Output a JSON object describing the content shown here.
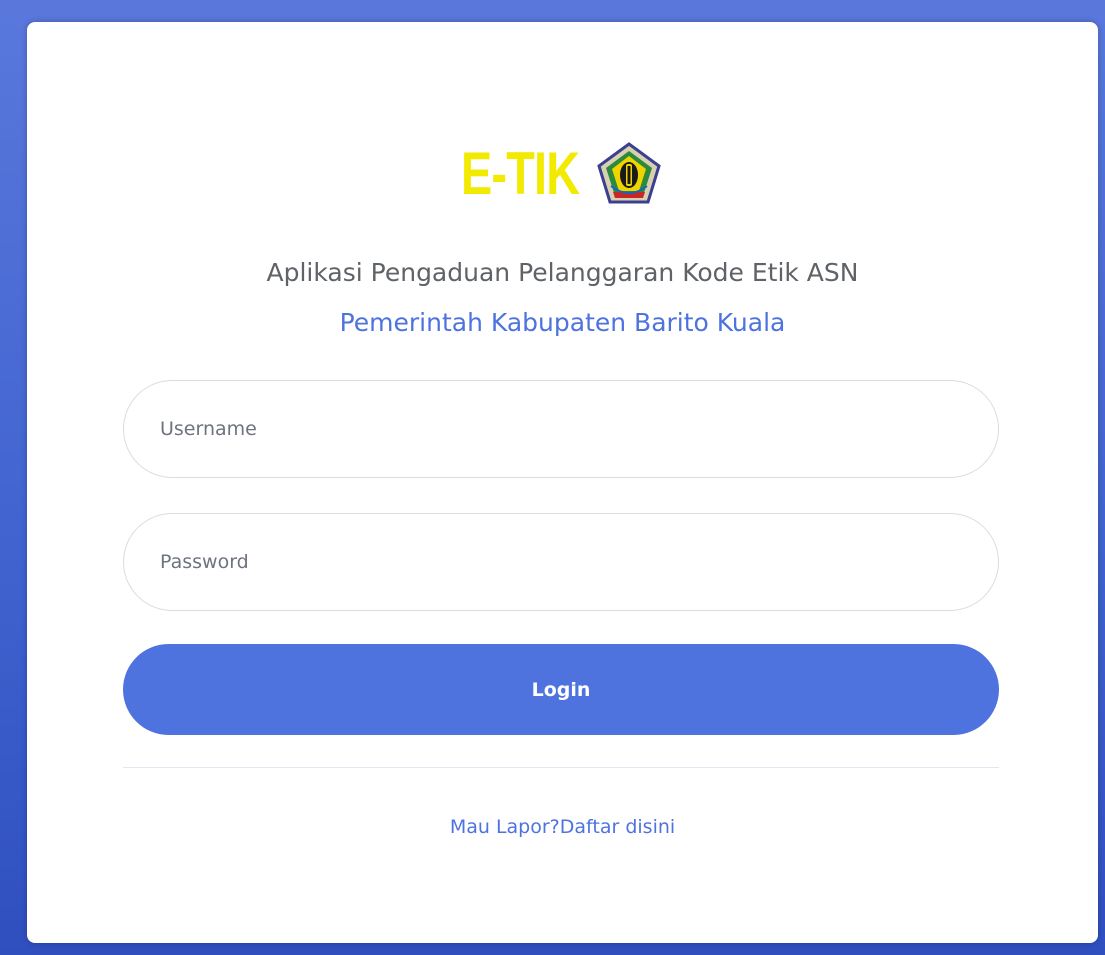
{
  "logo": {
    "text": "E-TIK",
    "text_color": "#f2ea00",
    "emblem_icon": "regency-emblem-icon"
  },
  "header": {
    "app_title": "Aplikasi Pengaduan Pelanggaran Kode Etik ASN",
    "org_name": "Pemerintah Kabupaten Barito Kuala"
  },
  "form": {
    "username_placeholder": "Username",
    "username_value": "",
    "password_placeholder": "Password",
    "password_value": "",
    "login_label": "Login"
  },
  "footer": {
    "register_link": "Mau Lapor?Daftar disini"
  },
  "colors": {
    "accent": "#4e73df",
    "background": "#4e73df",
    "card": "#ffffff"
  }
}
